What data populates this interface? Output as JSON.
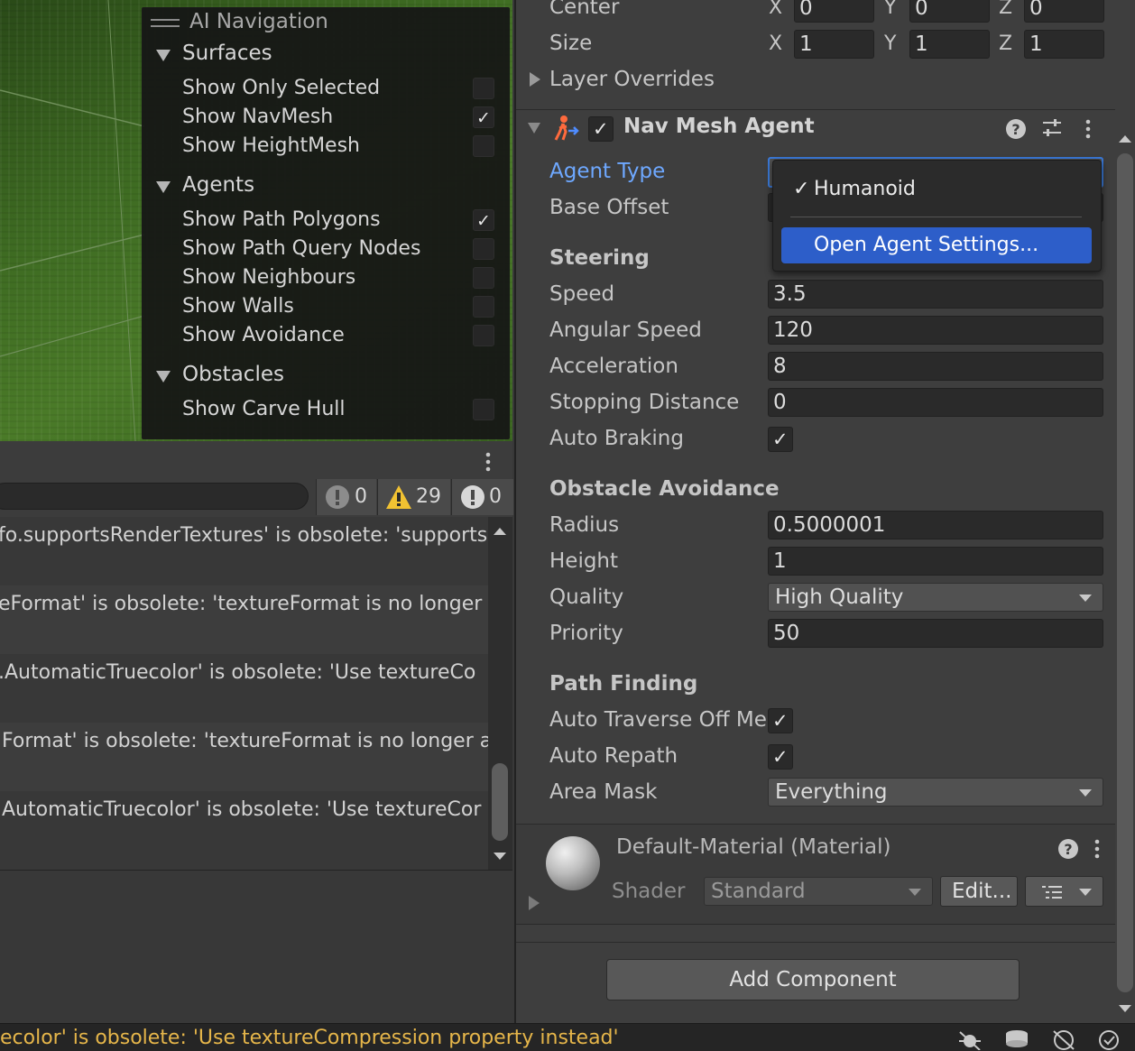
{
  "colors": {
    "accent": "#2d5ec9",
    "warning": "#e6b64a",
    "link_label": "#6ea8ff"
  },
  "ai_navigation": {
    "title": "AI Navigation",
    "surfaces": {
      "label": "Surfaces",
      "items": [
        {
          "label": "Show Only Selected",
          "checked": false
        },
        {
          "label": "Show NavMesh",
          "checked": true
        },
        {
          "label": "Show HeightMesh",
          "checked": false
        }
      ]
    },
    "agents": {
      "label": "Agents",
      "items": [
        {
          "label": "Show Path Polygons",
          "checked": true
        },
        {
          "label": "Show Path Query Nodes",
          "checked": false
        },
        {
          "label": "Show Neighbours",
          "checked": false
        },
        {
          "label": "Show Walls",
          "checked": false
        },
        {
          "label": "Show Avoidance",
          "checked": false
        }
      ]
    },
    "obstacles": {
      "label": "Obstacles",
      "items": [
        {
          "label": "Show Carve Hull",
          "checked": false
        }
      ]
    }
  },
  "console": {
    "counts": {
      "errors": "0",
      "warnings": "29",
      "messages": "0"
    },
    "rows": [
      "fo.supportsRenderTextures' is obsolete: 'supports",
      "eFormat' is obsolete: 'textureFormat is no longer a",
      ".AutomaticTruecolor' is obsolete: 'Use textureCo",
      "Format' is obsolete: 'textureFormat is no longer a",
      "AutomaticTruecolor' is obsolete: 'Use textureCor"
    ]
  },
  "status_bar": {
    "message": "ecolor' is obsolete: 'Use textureCompression property instead'"
  },
  "collider": {
    "center": {
      "label": "Center",
      "x": "0",
      "y": "0",
      "z": "0"
    },
    "size": {
      "label": "Size",
      "x": "1",
      "y": "1",
      "z": "1"
    },
    "axis_labels": {
      "x": "X",
      "y": "Y",
      "z": "Z"
    },
    "layer_overrides": "Layer Overrides"
  },
  "nav_mesh_agent": {
    "title": "Nav Mesh Agent",
    "enabled": true,
    "agent_type_label": "Agent Type",
    "base_offset_label": "Base Offset",
    "steering": {
      "title": "Steering",
      "speed_label": "Speed",
      "speed": "3.5",
      "angular_speed_label": "Angular Speed",
      "angular_speed": "120",
      "acceleration_label": "Acceleration",
      "acceleration": "8",
      "stopping_distance_label": "Stopping Distance",
      "stopping_distance": "0",
      "auto_braking_label": "Auto Braking",
      "auto_braking": true
    },
    "obstacle_avoidance": {
      "title": "Obstacle Avoidance",
      "radius_label": "Radius",
      "radius": "0.5000001",
      "height_label": "Height",
      "height": "1",
      "quality_label": "Quality",
      "quality": "High Quality",
      "priority_label": "Priority",
      "priority": "50"
    },
    "path_finding": {
      "title": "Path Finding",
      "auto_traverse_label": "Auto Traverse Off Me",
      "auto_traverse": true,
      "auto_repath_label": "Auto Repath",
      "auto_repath": true,
      "area_mask_label": "Area Mask",
      "area_mask": "Everything"
    }
  },
  "agent_type_popup": {
    "selected_item": "Humanoid",
    "check_glyph": "✓",
    "action_item": "Open Agent Settings..."
  },
  "material": {
    "name": "Default-Material (Material)",
    "shader_label": "Shader",
    "shader_value": "Standard",
    "edit_label": "Edit..."
  },
  "add_component_label": "Add Component"
}
